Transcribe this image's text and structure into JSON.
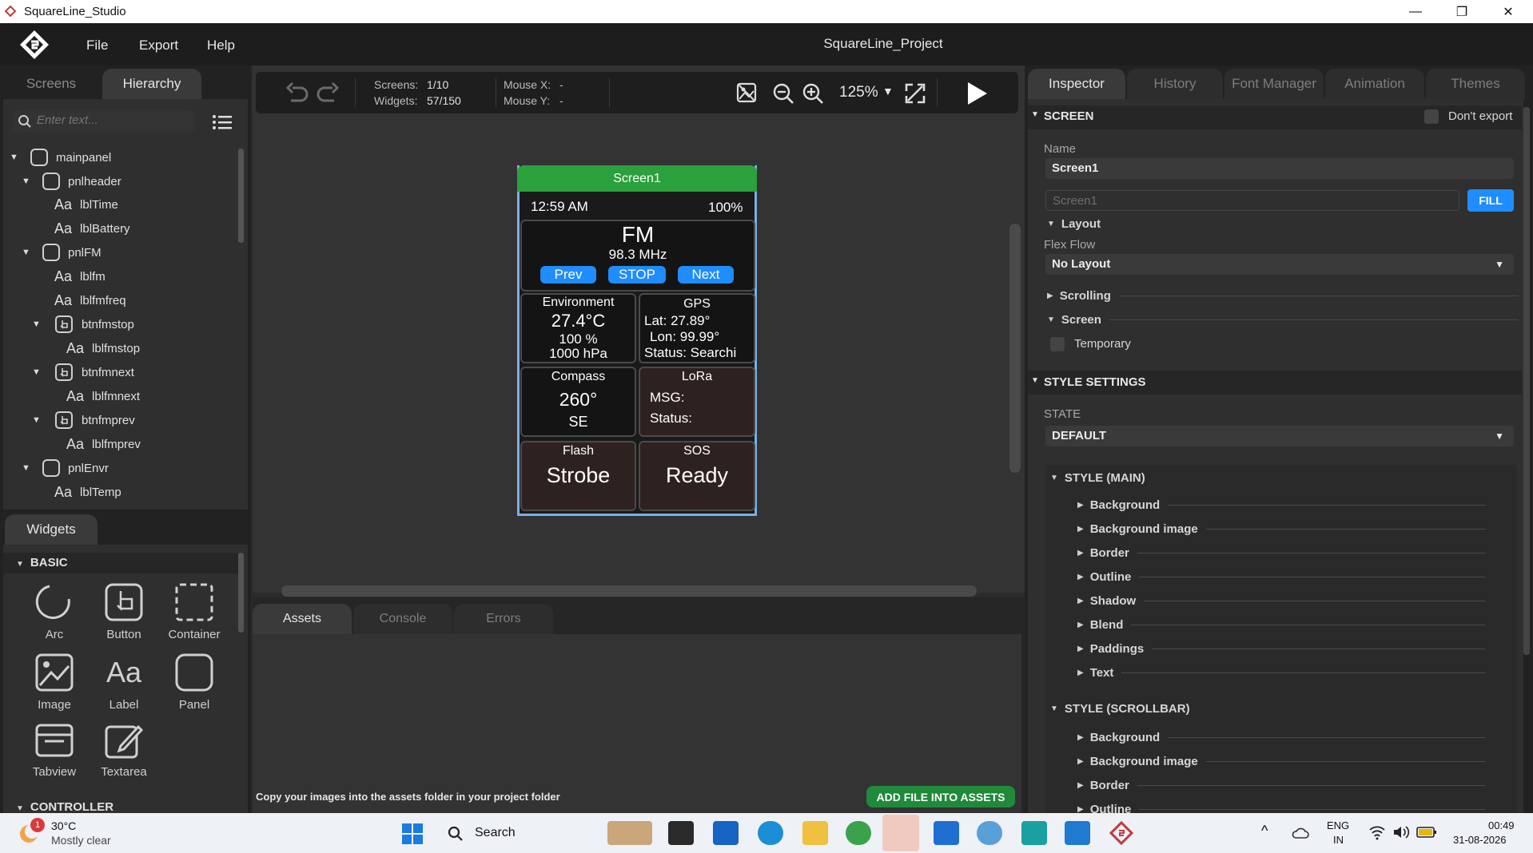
{
  "window": {
    "app_title": "SquareLine_Studio",
    "minimize": "—",
    "maximize": "❐",
    "close": "✕"
  },
  "menu": {
    "file": "File",
    "export": "Export",
    "help": "Help",
    "project_title": "SquareLine_Project"
  },
  "left_tabs": {
    "screens": "Screens",
    "hierarchy": "Hierarchy"
  },
  "search": {
    "placeholder": "Enter text..."
  },
  "tree": [
    {
      "label": "mainpanel",
      "kind": "panel",
      "expanded": true
    },
    {
      "label": "pnlheader",
      "kind": "panel",
      "expanded": true
    },
    {
      "label": "lblTime",
      "kind": "label"
    },
    {
      "label": "lblBattery",
      "kind": "label"
    },
    {
      "label": "pnlFM",
      "kind": "panel",
      "expanded": true
    },
    {
      "label": "lblfm",
      "kind": "label"
    },
    {
      "label": "lblfmfreq",
      "kind": "label"
    },
    {
      "label": "btnfmstop",
      "kind": "button",
      "expanded": true
    },
    {
      "label": "lblfmstop",
      "kind": "label"
    },
    {
      "label": "btnfmnext",
      "kind": "button",
      "expanded": true
    },
    {
      "label": "lblfmnext",
      "kind": "label"
    },
    {
      "label": "btnfmprev",
      "kind": "button",
      "expanded": true
    },
    {
      "label": "lblfmprev",
      "kind": "label"
    },
    {
      "label": "pnlEnvr",
      "kind": "panel",
      "expanded": true
    },
    {
      "label": "lblTemp",
      "kind": "label"
    }
  ],
  "widgets": {
    "tab": "Widgets",
    "group_basic": "BASIC",
    "group_controller": "CONTROLLER",
    "items": [
      "Arc",
      "Button",
      "Container",
      "Image",
      "Label",
      "Panel",
      "Tabview",
      "Textarea"
    ]
  },
  "toolbar": {
    "screens_label": "Screens:",
    "screens_value": "1/10",
    "widgets_label": "Widgets:",
    "widgets_value": "57/150",
    "mouse_x_label": "Mouse X:",
    "mouse_x_value": "-",
    "mouse_y_label": "Mouse Y:",
    "mouse_y_value": "-",
    "zoom": "125%"
  },
  "device": {
    "screen_name": "Screen1",
    "time": "12:59 AM",
    "battery": "100%",
    "fm_title": "FM",
    "fm_freq": "98.3 MHz",
    "btn_prev": "Prev",
    "btn_stop": "STOP",
    "btn_next": "Next",
    "env_title": "Environment",
    "env_temp": "27.4°C",
    "env_humidity": "100 %",
    "env_pressure": "1000 hPa",
    "gps_title": "GPS",
    "gps_lat": "Lat: 27.89°",
    "gps_lon": "Lon: 99.99°",
    "gps_status": "Status: Searchi",
    "compass_title": "Compass",
    "compass_deg": "260°",
    "compass_dir": "SE",
    "lora_title": "LoRa",
    "lora_msg": "MSG:",
    "lora_status": "Status:",
    "flash_title": "Flash",
    "flash_value": "Strobe",
    "sos_title": "SOS",
    "sos_value": "Ready"
  },
  "bottom_tabs": {
    "assets": "Assets",
    "console": "Console",
    "errors": "Errors"
  },
  "assets": {
    "hint": "Copy your images into the assets folder in your project folder",
    "add_button": "ADD FILE INTO ASSETS"
  },
  "right_tabs": {
    "inspector": "Inspector",
    "history": "History",
    "font_manager": "Font Manager",
    "animation": "Animation",
    "themes": "Themes"
  },
  "inspector": {
    "screen_header": "SCREEN",
    "dont_export": "Don't export",
    "name_label": "Name",
    "name_value": "Screen1",
    "fill_placeholder": "Screen1",
    "fill_button": "FILL",
    "layout": "Layout",
    "flex_flow_label": "Flex Flow",
    "flex_flow_value": "No Layout",
    "scrolling": "Scrolling",
    "screen_sub": "Screen",
    "temporary": "Temporary",
    "style_settings": "STYLE SETTINGS",
    "state_label": "STATE",
    "state_value": "DEFAULT",
    "style_main": "STYLE (MAIN)",
    "style_main_items": [
      "Background",
      "Background image",
      "Border",
      "Outline",
      "Shadow",
      "Blend",
      "Paddings",
      "Text"
    ],
    "style_scrollbar": "STYLE (SCROLLBAR)",
    "style_scrollbar_items": [
      "Background",
      "Background image",
      "Border",
      "Outline"
    ]
  },
  "taskbar": {
    "weather_temp": "30°C",
    "weather_desc": "Mostly clear",
    "weather_badge": "1",
    "search": "Search",
    "lang_top": "ENG",
    "lang_bottom": "IN",
    "time": "00:49",
    "date": "31-08-2026"
  }
}
